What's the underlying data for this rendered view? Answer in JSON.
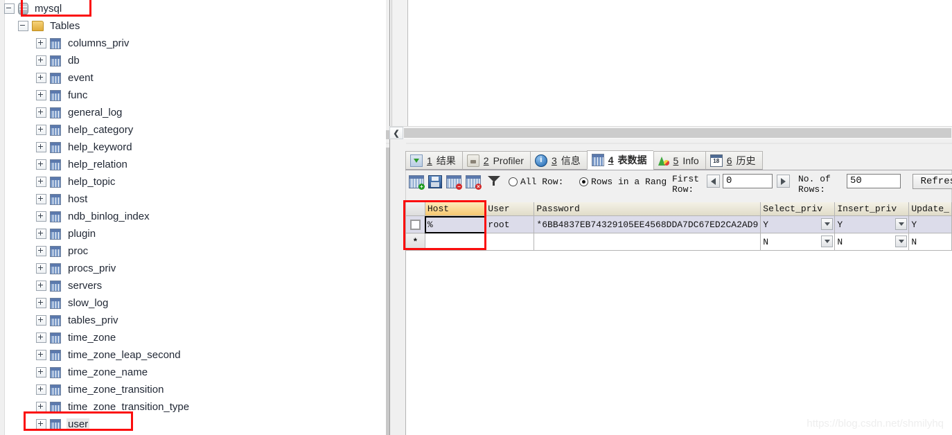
{
  "tree": {
    "root": {
      "label": "mysql",
      "icon": "database-icon",
      "expander": "minus"
    },
    "tables_node": {
      "label": "Tables",
      "icon": "folder-icon",
      "expander": "minus"
    },
    "tables": [
      {
        "label": "columns_priv"
      },
      {
        "label": "db"
      },
      {
        "label": "event"
      },
      {
        "label": "func"
      },
      {
        "label": "general_log"
      },
      {
        "label": "help_category"
      },
      {
        "label": "help_keyword"
      },
      {
        "label": "help_relation"
      },
      {
        "label": "help_topic"
      },
      {
        "label": "host"
      },
      {
        "label": "ndb_binlog_index"
      },
      {
        "label": "plugin"
      },
      {
        "label": "proc"
      },
      {
        "label": "procs_priv"
      },
      {
        "label": "servers"
      },
      {
        "label": "slow_log"
      },
      {
        "label": "tables_priv"
      },
      {
        "label": "time_zone"
      },
      {
        "label": "time_zone_leap_second"
      },
      {
        "label": "time_zone_name"
      },
      {
        "label": "time_zone_transition"
      },
      {
        "label": "time_zone_transition_type"
      },
      {
        "label": "user"
      }
    ],
    "selected": "user"
  },
  "annotations": {
    "color": "#fb0d0d",
    "boxes": [
      "mysql-node-highlight",
      "user-node-highlight",
      "host-cell-highlight"
    ]
  },
  "scrollbar": {
    "left_arrow": "❮"
  },
  "tabs": [
    {
      "num": "1",
      "label": "结果",
      "icon": "result-grid-icon",
      "active": false
    },
    {
      "num": "2",
      "label": "Profiler",
      "icon": "profiler-icon",
      "active": false
    },
    {
      "num": "3",
      "label": "信息",
      "icon": "info-circle-icon",
      "active": false
    },
    {
      "num": "4",
      "label": "表数据",
      "icon": "table-data-icon",
      "active": true
    },
    {
      "num": "5",
      "label": "Info",
      "icon": "chart-icon",
      "active": false
    },
    {
      "num": "6",
      "label": "历史",
      "icon": "calendar-icon",
      "active": false
    }
  ],
  "grid_toolbar": {
    "icons": [
      {
        "name": "add-record-icon",
        "badge": "+",
        "badge_color": "#1f9b1f"
      },
      {
        "name": "save-record-icon",
        "badge": "",
        "badge_color": ""
      },
      {
        "name": "delete-record-icon",
        "badge": "−",
        "badge_color": "#d42a2a"
      },
      {
        "name": "cancel-record-icon",
        "badge": "×",
        "badge_color": "#d42a2a"
      },
      {
        "name": "filter-funnel-icon",
        "badge": "",
        "badge_color": ""
      }
    ],
    "radio_all_rows": {
      "label": "All Row:",
      "selected": false
    },
    "radio_rows_in_range": {
      "label": "Rows in a Rang",
      "selected": true
    },
    "first_row_label": "First\nRow:",
    "first_row_label_line1": "First",
    "first_row_label_line2": "Row:",
    "first_row_value": "0",
    "no_of_rows_label_line1": "No. of",
    "no_of_rows_label_line2": "Rows:",
    "no_of_rows_value": "50",
    "refresh_label": "Refresh"
  },
  "grid": {
    "columns": [
      "Host",
      "User",
      "Password",
      "Select_priv",
      "Insert_priv",
      "Update_"
    ],
    "selected_column": "Host",
    "rows": [
      {
        "marker": "edit",
        "cells": [
          "%",
          "root",
          "*6BB4837EB74329105EE4568DDA7DC67ED2CA2AD9",
          "Y",
          "Y",
          "Y"
        ]
      },
      {
        "marker": "*",
        "cells": [
          "",
          "",
          "",
          "N",
          "N",
          "N"
        ]
      }
    ]
  },
  "watermark": "https://blog.csdn.net/shmilyhq"
}
